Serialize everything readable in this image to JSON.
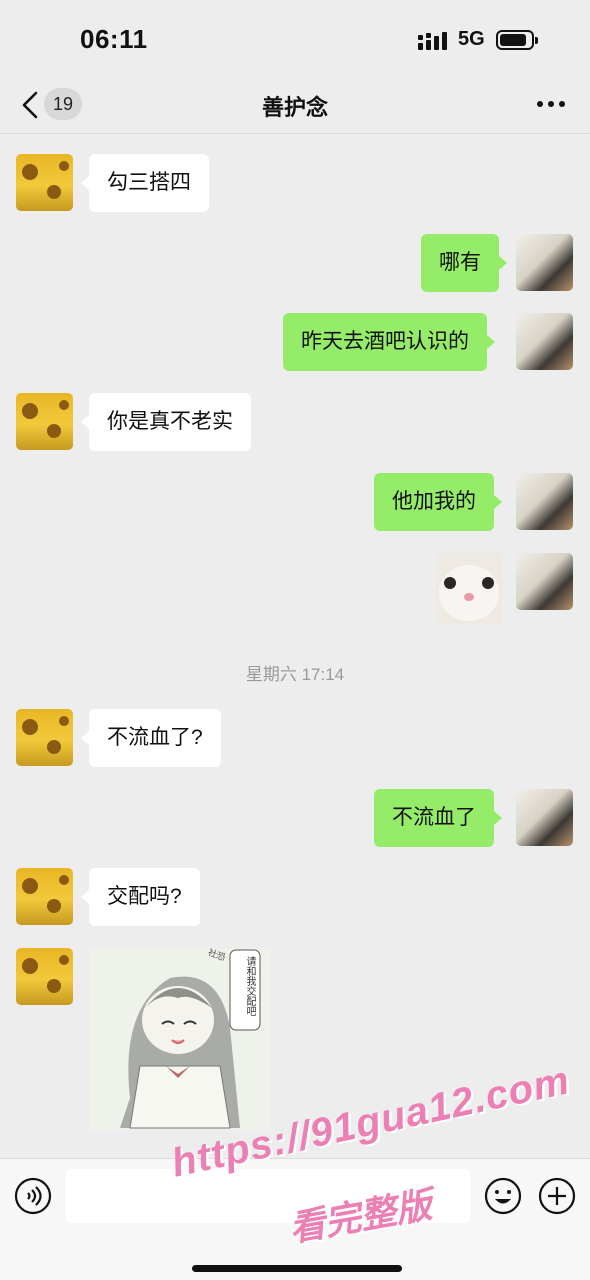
{
  "status": {
    "time": "06:11",
    "network": "5G",
    "battery_level": 0.85
  },
  "nav": {
    "badge": "19",
    "title": "善护念"
  },
  "messages": [
    {
      "side": "left",
      "text": "勾三搭四"
    },
    {
      "side": "right",
      "text": "哪有"
    },
    {
      "side": "right",
      "text": "昨天去酒吧认识的"
    },
    {
      "side": "left",
      "text": "你是真不老实"
    },
    {
      "side": "right",
      "text": "他加我的"
    },
    {
      "side": "right",
      "type": "sticker",
      "icon": "cat-face-sticker"
    },
    {
      "side": "left",
      "text": "不流血了?"
    },
    {
      "side": "right",
      "text": "不流血了"
    },
    {
      "side": "left",
      "text": "交配吗?"
    },
    {
      "side": "left",
      "type": "sticker",
      "icon": "anime-girl-sticker"
    }
  ],
  "time_separator": "星期六 17:14",
  "sticker_anime": {
    "speech_text": "请和我交配吧",
    "side_text": "社恐"
  },
  "input": {
    "placeholder": ""
  },
  "watermark": {
    "line1": "https://91gua12.com",
    "line2": "看完整版"
  },
  "colors": {
    "background": "#EDEDED",
    "bubble_mine": "#95EC69",
    "bubble_other": "#FFFFFF",
    "watermark": "#EC7FB3"
  }
}
